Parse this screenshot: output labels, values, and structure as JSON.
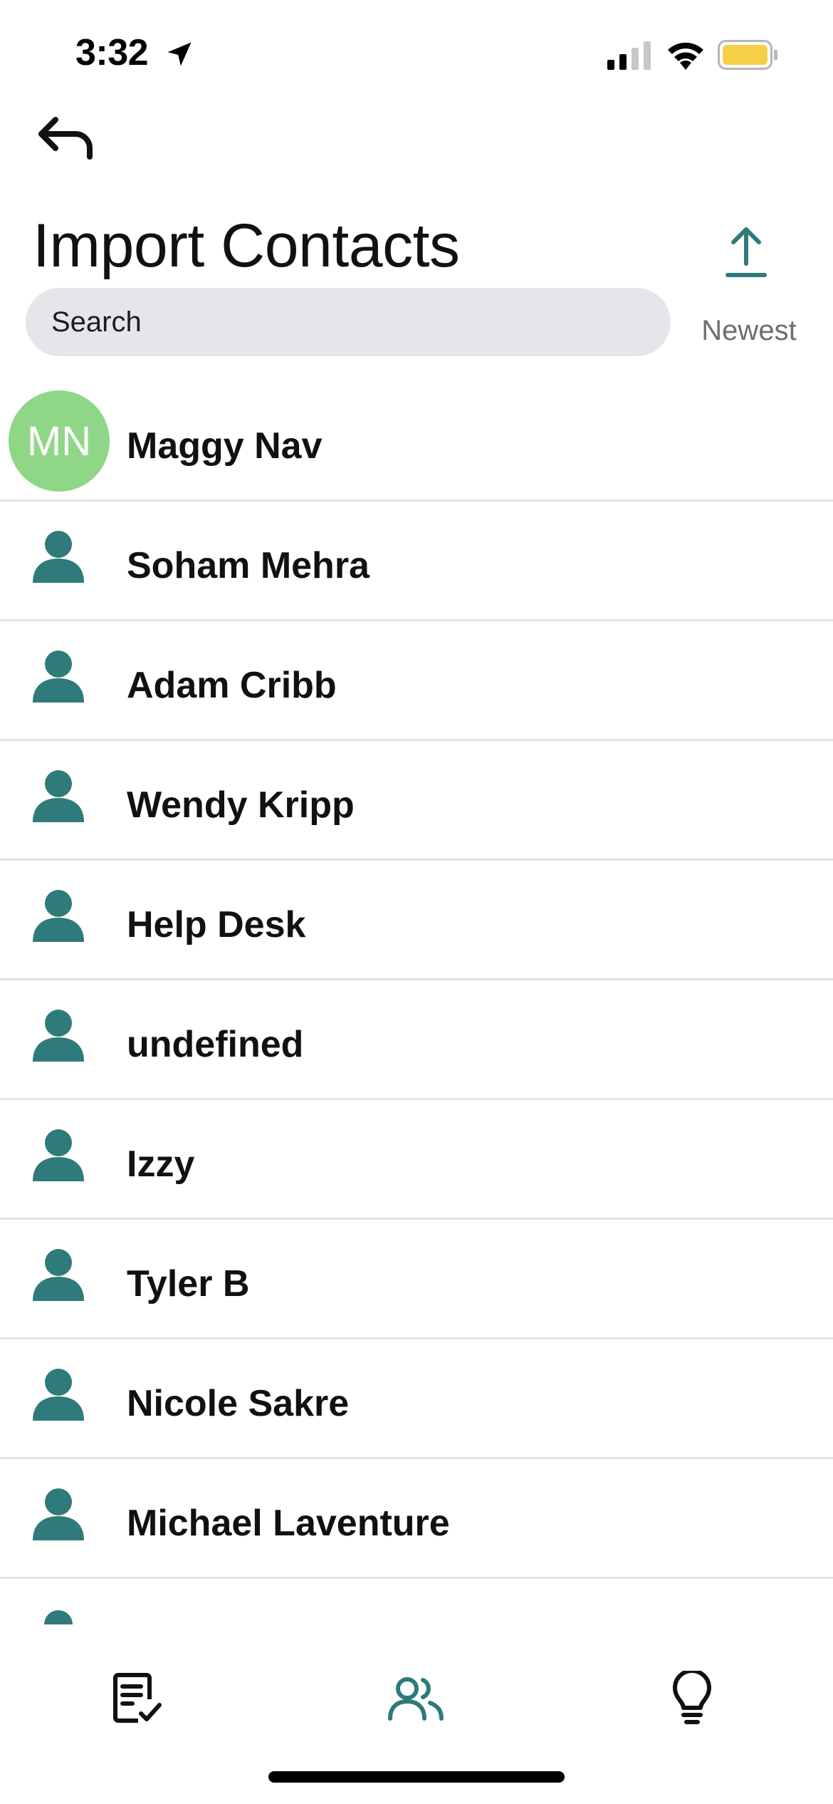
{
  "status_bar": {
    "time": "3:32",
    "icons": [
      "location-arrow-icon",
      "cellular-signal-icon",
      "wifi-icon",
      "battery-icon"
    ],
    "battery_color": "#f7cf46"
  },
  "header": {
    "back_icon": "back-arrow-icon",
    "title": "Import Contacts",
    "sort_icon": "upload-arrow-icon",
    "sort_label": "Newest"
  },
  "search": {
    "placeholder": "Search",
    "value": ""
  },
  "contacts": [
    {
      "name": "Maggy Nav",
      "initials": "MN",
      "avatar": "initials"
    },
    {
      "name": "Soham Mehra",
      "avatar": "person-icon"
    },
    {
      "name": "Adam Cribb",
      "avatar": "person-icon"
    },
    {
      "name": "Wendy Kripp",
      "avatar": "person-icon"
    },
    {
      "name": "Help Desk",
      "avatar": "person-icon"
    },
    {
      "name": "undefined",
      "avatar": "person-icon"
    },
    {
      "name": "Izzy",
      "avatar": "person-icon"
    },
    {
      "name": "Tyler B",
      "avatar": "person-icon"
    },
    {
      "name": "Nicole Sakre",
      "avatar": "person-icon"
    },
    {
      "name": "Michael Laventure",
      "avatar": "person-icon"
    }
  ],
  "tab_bar": {
    "tabs": [
      {
        "icon": "checklist-icon",
        "active": false
      },
      {
        "icon": "people-icon",
        "active": true
      },
      {
        "icon": "lightbulb-icon",
        "active": false
      }
    ]
  },
  "colors": {
    "accent": "#2f7a7a",
    "avatar_green": "#8fd787",
    "divider": "#e4e4e6",
    "search_bg": "#e5e6ea",
    "muted_text": "#6e6e72"
  }
}
